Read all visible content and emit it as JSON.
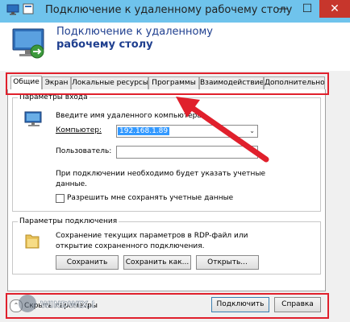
{
  "window": {
    "title": "Подключение к удаленному рабочему столу",
    "minimize_glyph": "—",
    "maximize_glyph": "☐",
    "close_glyph": "✕"
  },
  "header": {
    "line1": "Подключение к удаленному",
    "line2": "рабочему столу"
  },
  "tabs": [
    {
      "label": "Общие",
      "active": true
    },
    {
      "label": "Экран",
      "active": false
    },
    {
      "label": "Локальные ресурсы",
      "active": false
    },
    {
      "label": "Программы",
      "active": false
    },
    {
      "label": "Взаимодействие",
      "active": false
    },
    {
      "label": "Дополнительно",
      "active": false
    }
  ],
  "login_group": {
    "title": "Параметры входа",
    "prompt": "Введите имя удаленного компьютера.",
    "computer_label": "Компьютер:",
    "computer_value": "192.168.1.89",
    "user_label": "Пользователь:",
    "user_value": "",
    "note": "При подключении необходимо будет указать учетные данные.",
    "note_line1": "При подключении необходимо будет указать учетные",
    "note_line2": "данные.",
    "save_creds_label": "Разрешить мне сохранять учетные данные",
    "save_creds_checked": false
  },
  "connection_group": {
    "title": "Параметры подключения",
    "desc_line1": "Сохранение текущих параметров в RDP-файл или",
    "desc_line2": "открытие сохраненного подключения.",
    "save_button": "Сохранить",
    "save_as_button": "Сохранить как...",
    "open_button": "Открыть..."
  },
  "footer": {
    "hide_params": "Скрыть параметры",
    "connect_button": "Подключить",
    "help_button": "Справка"
  },
  "watermark": "WINDWIX.RU",
  "colors": {
    "titlebar": "#6fc3ec",
    "close": "#c7362c",
    "header_text": "#1f3f8f",
    "highlight_red": "#e0202c",
    "selection": "#3399ff"
  }
}
